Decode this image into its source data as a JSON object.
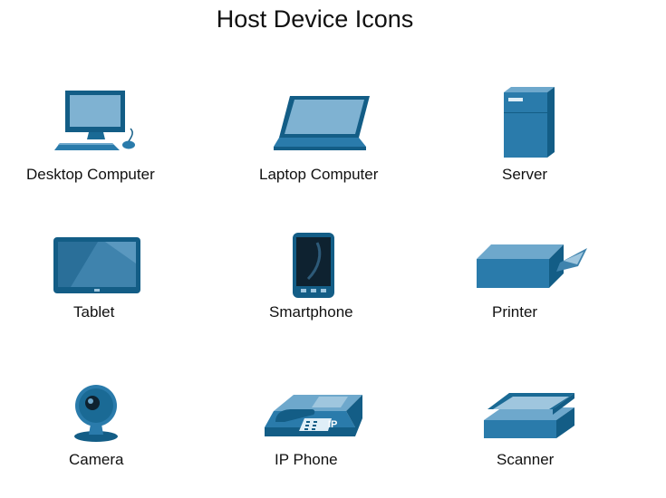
{
  "title": "Host Device Icons",
  "colors": {
    "device_dark": "#135d86",
    "device_mid": "#2a7bab",
    "device_light": "#6ea8cc",
    "screen": "#7fb2d2",
    "text": "#111111"
  },
  "devices": [
    {
      "label": "Desktop Computer",
      "icon": "desktop-computer-icon"
    },
    {
      "label": "Laptop Computer",
      "icon": "laptop-computer-icon"
    },
    {
      "label": "Server",
      "icon": "server-icon"
    },
    {
      "label": "Tablet",
      "icon": "tablet-icon"
    },
    {
      "label": "Smartphone",
      "icon": "smartphone-icon"
    },
    {
      "label": "Printer",
      "icon": "printer-icon"
    },
    {
      "label": "Camera",
      "icon": "camera-icon"
    },
    {
      "label": "IP Phone",
      "icon": "ip-phone-icon",
      "badge": "IP"
    },
    {
      "label": "Scanner",
      "icon": "scanner-icon"
    }
  ]
}
